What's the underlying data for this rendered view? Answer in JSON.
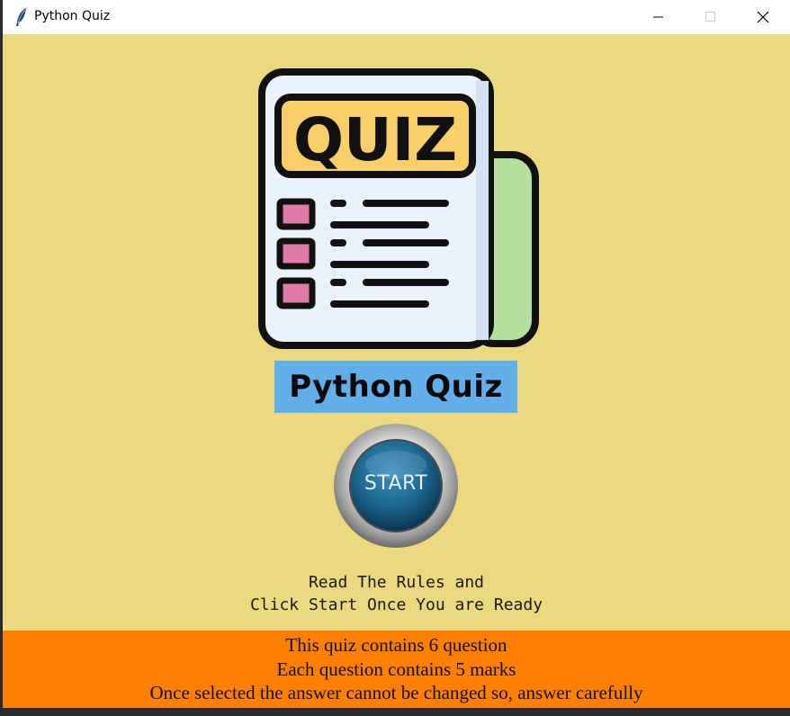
{
  "window": {
    "title": "Python Quiz",
    "controls": {
      "minimize": "minimize-icon",
      "maximize": "maximize-icon",
      "close": "close-icon"
    }
  },
  "logo": {
    "text": "QUIZ",
    "icon": "quiz-newspaper-icon"
  },
  "heading": {
    "text": "Python Quiz"
  },
  "start_button": {
    "label": "START"
  },
  "rules": {
    "line1": "Read The Rules and",
    "line2": "Click Start Once You are Ready"
  },
  "info": {
    "line1": "This quiz contains 6 question",
    "line2": "Each question contains 5 marks",
    "line3": "Once selected the answer cannot be changed so, answer carefully"
  },
  "colors": {
    "background": "#ecd87f",
    "heading_box": "#62aee8",
    "info_bar": "#ff7f00",
    "start_button": "#1e6a94"
  }
}
